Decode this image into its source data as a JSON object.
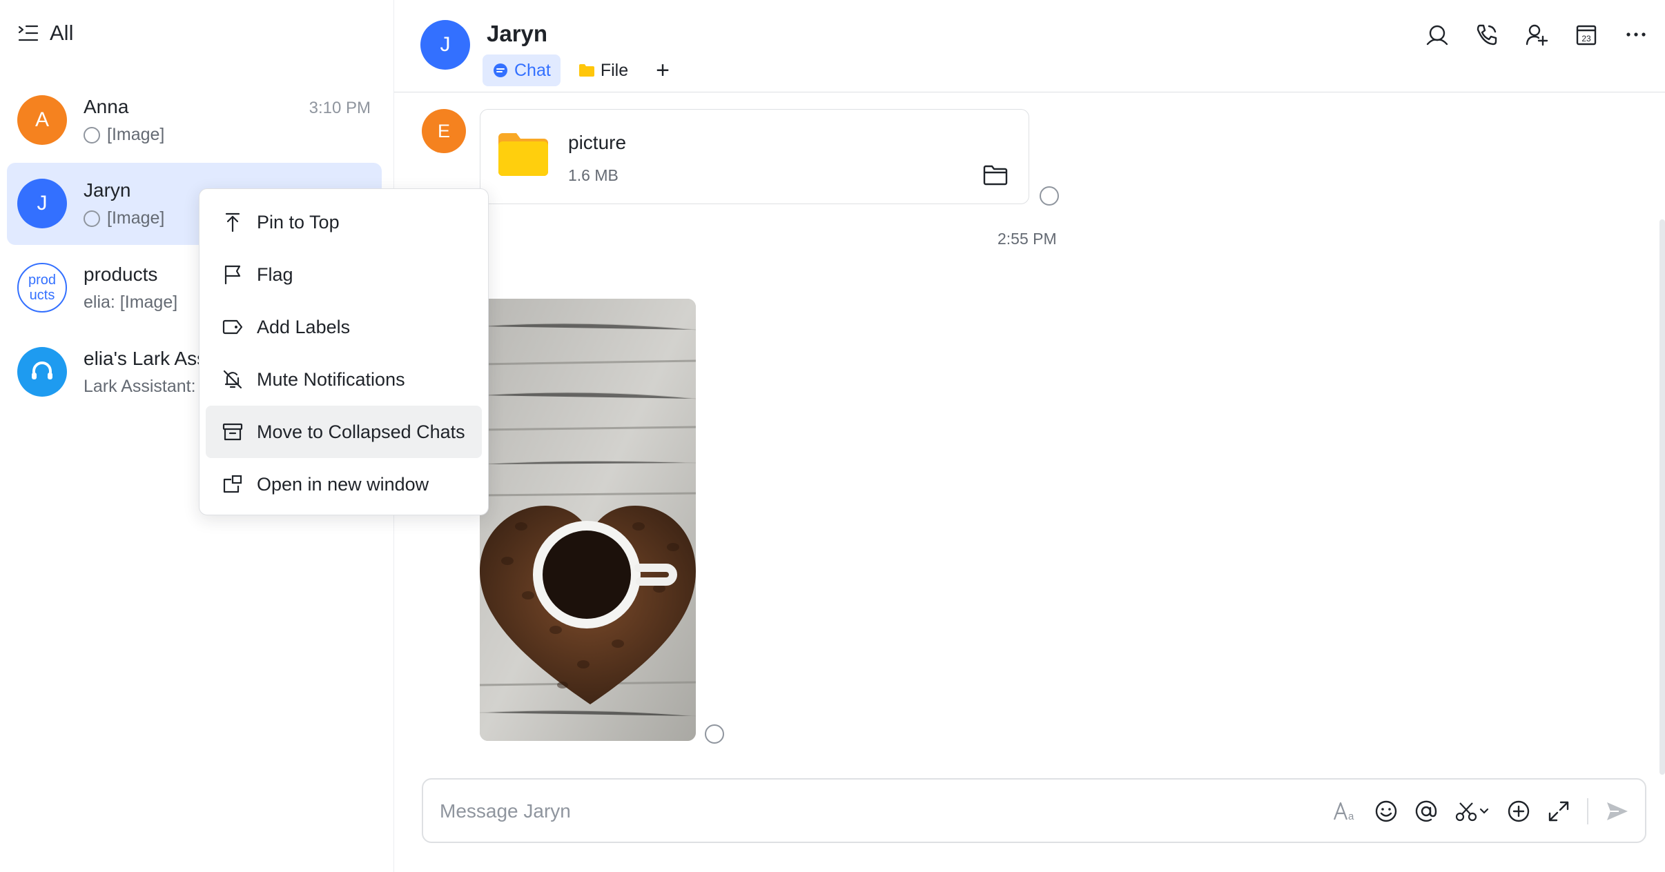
{
  "sidebar": {
    "filter_label": "All",
    "chats": [
      {
        "name": "Anna",
        "preview": "[Image]",
        "time": "3:10 PM",
        "avatar_letter": "A",
        "avatar_color": "#f5821f"
      },
      {
        "name": "Jaryn",
        "preview": "[Image]",
        "time": "",
        "avatar_letter": "J",
        "avatar_color": "#3370ff"
      },
      {
        "name": "products",
        "preview": "elia: [Image]",
        "time": "",
        "avatar_line1": "prod",
        "avatar_line2": "ucts"
      },
      {
        "name": "elia's Lark Ass",
        "preview": "Lark Assistant: I",
        "time": "",
        "avatar_color": "#1e9bf0"
      }
    ]
  },
  "header": {
    "avatar_letter": "J",
    "title": "Jaryn",
    "tabs": [
      {
        "label": "Chat",
        "active": true
      },
      {
        "label": "File",
        "active": false
      }
    ],
    "add_tab": "+",
    "actions": [
      "search-icon",
      "phone-icon",
      "add-member-icon",
      "calendar-icon",
      "more-icon"
    ],
    "calendar_day": "23"
  },
  "messages": {
    "sender_avatar_letter": "E",
    "file": {
      "name": "picture",
      "size": "1.6 MB"
    },
    "time_separator": "2:55 PM"
  },
  "composer": {
    "placeholder": "Message Jaryn",
    "tools": [
      "text-format-icon",
      "emoji-icon",
      "mention-icon",
      "screenshot-icon",
      "add-icon",
      "expand-icon",
      "send-icon"
    ]
  },
  "context_menu": {
    "items": [
      {
        "label": "Pin to Top",
        "icon": "pin-top-icon"
      },
      {
        "label": "Flag",
        "icon": "flag-icon"
      },
      {
        "label": "Add Labels",
        "icon": "label-icon"
      },
      {
        "label": "Mute Notifications",
        "icon": "mute-icon"
      },
      {
        "label": "Move to Collapsed Chats",
        "icon": "archive-icon",
        "highlighted": true
      },
      {
        "label": "Open in new window",
        "icon": "new-window-icon"
      }
    ]
  },
  "colors": {
    "accent": "#3370ff",
    "active_bg": "#e1eaff",
    "orange": "#f5821f",
    "assistant_blue": "#1e9bf0"
  }
}
